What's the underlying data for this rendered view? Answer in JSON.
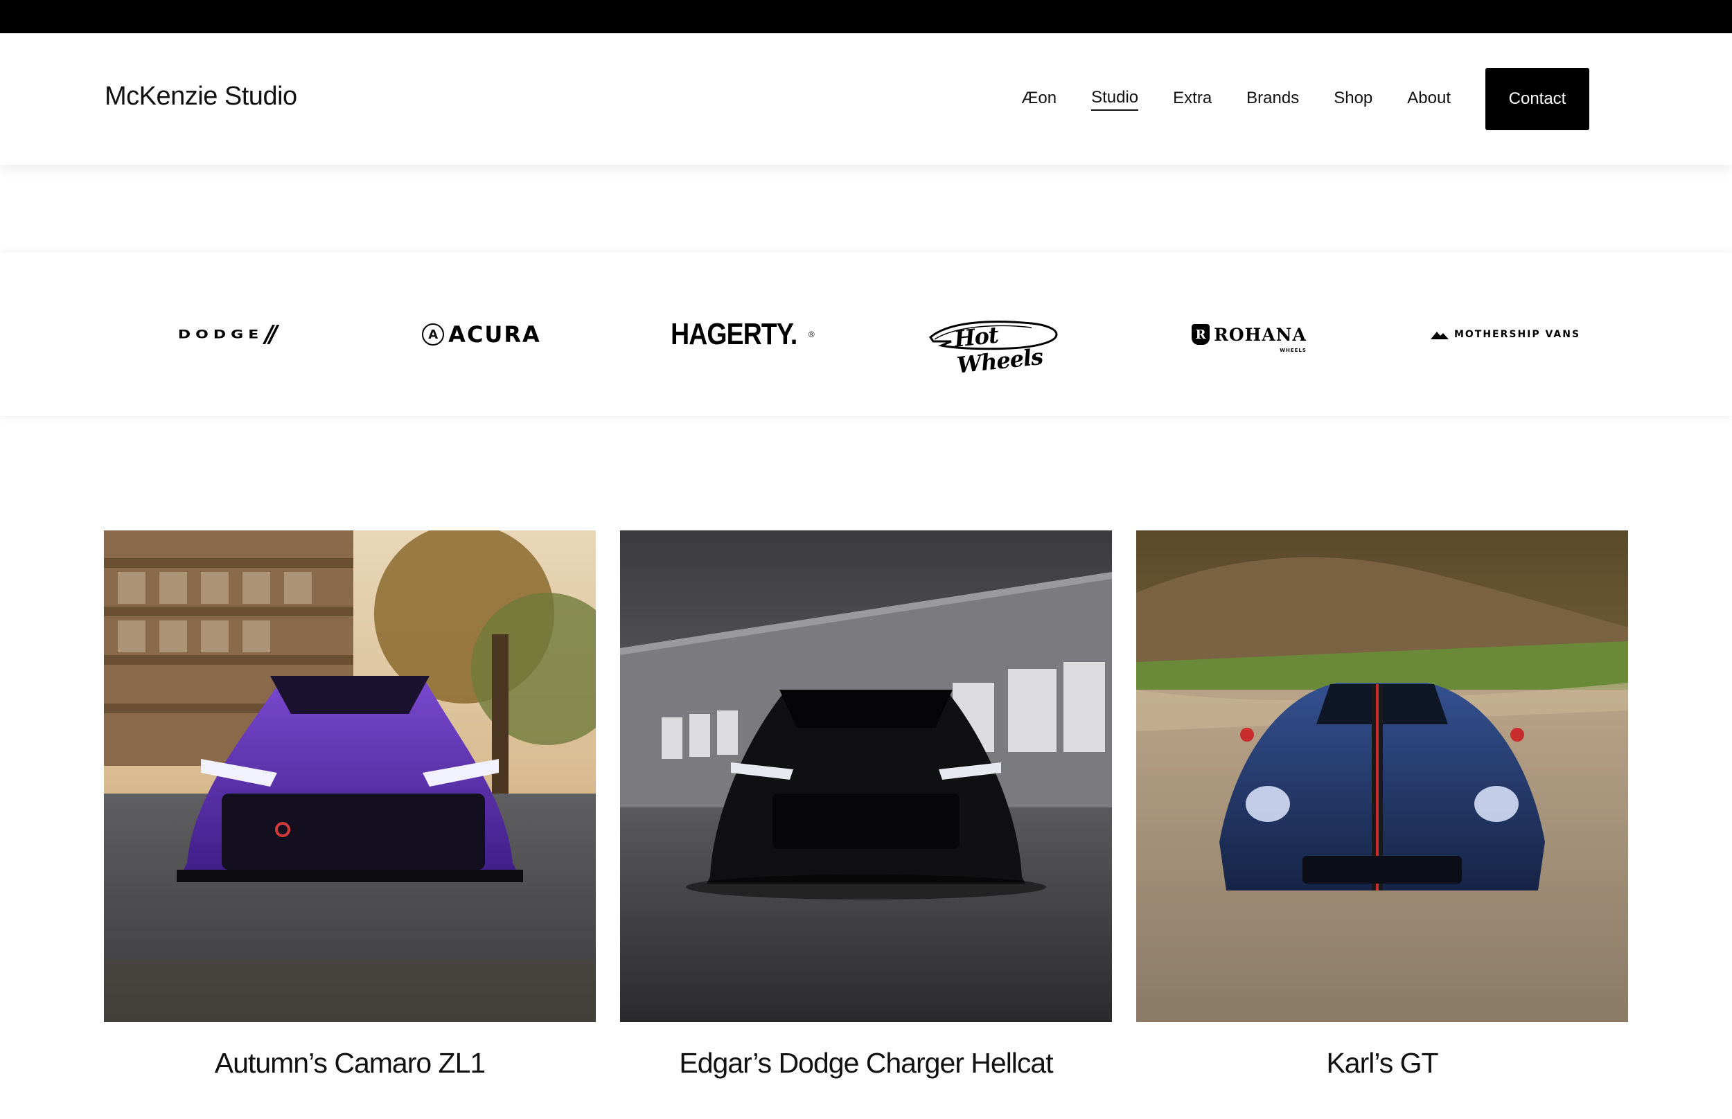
{
  "site": {
    "name": "McKenzie Studio"
  },
  "nav": {
    "items": [
      {
        "label": "Æon"
      },
      {
        "label": "Studio"
      },
      {
        "label": "Extra"
      },
      {
        "label": "Brands"
      },
      {
        "label": "Shop"
      },
      {
        "label": "About"
      }
    ],
    "active": "Studio",
    "contact_label": "Contact"
  },
  "brands": {
    "logos": [
      {
        "label": "DODGE",
        "icon": "dodge-logo"
      },
      {
        "label": "ACURA",
        "icon": "acura-logo"
      },
      {
        "label": "HAGERTY.",
        "icon": "hagerty-logo"
      },
      {
        "label": "Hot Wheels",
        "icon": "hot-wheels-logo"
      },
      {
        "label": "ROHANA",
        "sub": "WHEELS",
        "icon": "rohana-logo"
      },
      {
        "label": "MOTHERSHIP VANS",
        "icon": "mothership-vans-logo"
      }
    ]
  },
  "gallery": {
    "items": [
      {
        "caption": "Autumn’s Camaro ZL1",
        "car_color": "#5a2fa8",
        "scene": "purple camaro in front of wooden building"
      },
      {
        "caption": "Edgar’s Dodge Charger Hellcat",
        "car_color": "#0f0f12",
        "scene": "black charger in front of warehouse"
      },
      {
        "caption": "Karl’s GT",
        "car_color": "#1f2f5a",
        "scene": "blue ford gt on gravel road"
      }
    ]
  }
}
